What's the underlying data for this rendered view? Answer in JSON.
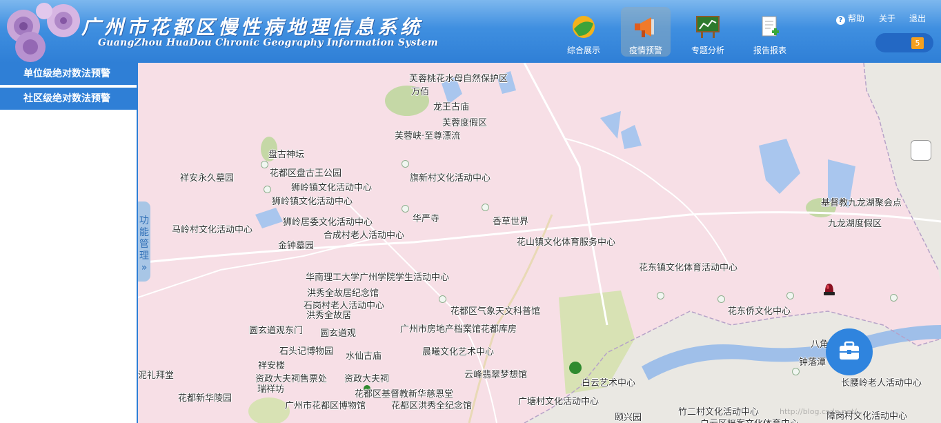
{
  "header": {
    "title_cn": "广州市花都区慢性病地理信息系统",
    "title_en": "GuangZhou HuaDou Chronic Geography Information System",
    "nav": [
      {
        "label": "综合展示",
        "icon": "globe-icon"
      },
      {
        "label": "疫情预警",
        "icon": "megaphone-icon",
        "active": true
      },
      {
        "label": "专题分析",
        "icon": "chart-board-icon"
      },
      {
        "label": "报告报表",
        "icon": "report-add-icon"
      }
    ],
    "help": "帮助",
    "about": "关于",
    "logout": "退出",
    "message_count": "5"
  },
  "sidebar": {
    "items": [
      {
        "label": "单位级绝对数法预警"
      },
      {
        "label": "社区级绝对数法预警"
      }
    ]
  },
  "map": {
    "function_tab": "功能管理",
    "function_tab_arrow": "»",
    "watermark": "http://blog.csdn.net/",
    "pois": [
      "芙蓉桃花水母自然保护区",
      "万佰",
      "龙王古庙",
      "芙蓉度假区",
      "芙蓉峡·至尊漂流",
      "盘古神坛",
      "祥安永久墓园",
      "花都区盘古王公园",
      "旗新村文化活动中心",
      "狮岭镇文化活动中心",
      "狮岭镇文化活动中心",
      "狮岭居委文化活动中心",
      "华严寺",
      "香草世界",
      "马岭村文化活动中心",
      "合成村老人活动中心",
      "花山镇文化体育服务中心",
      "金钟墓园",
      "花东镇文化体育活动中心",
      "华南理工大学广州学院学生活动中心",
      "洪秀全故居纪念馆",
      "石岗村老人活动中心",
      "洪秀全故居",
      "花都区气象天文科普馆",
      "花东侨文化中心",
      "圆玄道观东门",
      "圆玄道观",
      "广州市房地产档案馆花都库房",
      "石头记博物园",
      "晨曦文化艺术中心",
      "水仙古庙",
      "祥安楼",
      "泥礼拜堂",
      "云峰翡翠梦想馆",
      "资政大夫祠售票处",
      "资政大夫祠",
      "瑞祥坊",
      "花都区基督教新华慈恩堂",
      "花都新华陵园",
      "广州市花都区博物馆",
      "花都区洪秀全纪念馆",
      "广塘村文化活动中心",
      "白云艺术中心",
      "颐兴园",
      "竹二村文化活动中心",
      "白云区档案文化体育中心",
      "基督教九龙湖聚会点",
      "九龙湖度假区",
      "八角",
      "钟落潭",
      "长腰岭老人活动中心",
      "障岗村文化活动中心"
    ]
  }
}
